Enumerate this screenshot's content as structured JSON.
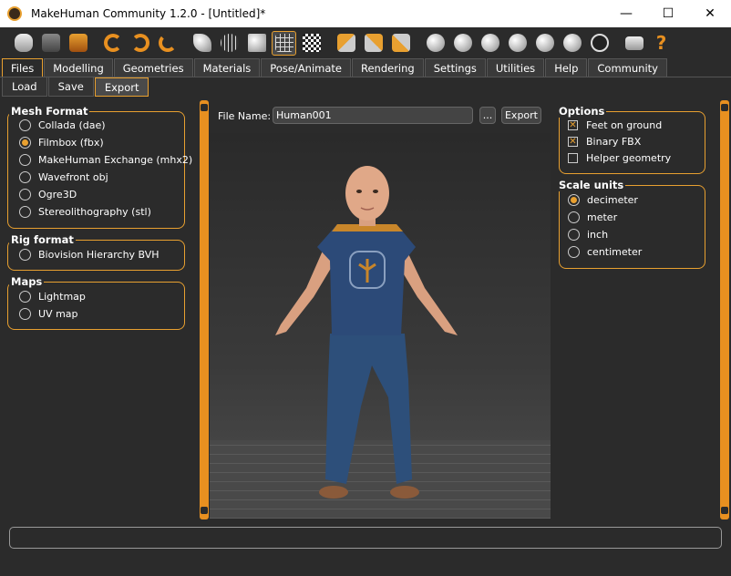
{
  "window": {
    "title": "MakeHuman Community 1.2.0 - [Untitled]*",
    "minimize": "—",
    "maximize": "☐",
    "close": "✕"
  },
  "main_tabs": [
    "Files",
    "Modelling",
    "Geometries",
    "Materials",
    "Pose/Animate",
    "Rendering",
    "Settings",
    "Utilities",
    "Help",
    "Community"
  ],
  "active_main_tab": "Files",
  "sub_tabs": [
    "Load",
    "Save",
    "Export"
  ],
  "active_sub_tab": "Export",
  "mesh_format": {
    "title": "Mesh Format",
    "options": [
      "Collada (dae)",
      "Filmbox (fbx)",
      "MakeHuman Exchange (mhx2)",
      "Wavefront obj",
      "Ogre3D",
      "Stereolithography (stl)"
    ],
    "selected": "Filmbox (fbx)"
  },
  "rig_format": {
    "title": "Rig format",
    "options": [
      "Biovision Hierarchy BVH"
    ]
  },
  "maps": {
    "title": "Maps",
    "options": [
      "Lightmap",
      "UV map"
    ]
  },
  "file": {
    "label": "File Name:",
    "value": "Human001",
    "browse_label": "...",
    "export_label": "Export"
  },
  "options": {
    "title": "Options",
    "items": [
      {
        "label": "Feet on ground",
        "checked": true
      },
      {
        "label": "Binary FBX",
        "checked": true
      },
      {
        "label": "Helper geometry",
        "checked": false
      }
    ]
  },
  "scale_units": {
    "title": "Scale units",
    "options": [
      "decimeter",
      "meter",
      "inch",
      "centimeter"
    ],
    "selected": "decimeter"
  },
  "toolbar_icons": [
    "new-icon",
    "save-icon",
    "export-icon",
    "undo-icon",
    "redo-icon",
    "reset-icon",
    "smooth-icon",
    "wireframe-icon",
    "pose-icon",
    "grid-icon",
    "checker-icon",
    "front-view-icon",
    "left-view-icon",
    "right-view-icon",
    "face-icon",
    "back-icon",
    "side-icon",
    "side2-icon",
    "top-icon",
    "bottom-icon",
    "circle-icon",
    "camera-icon",
    "help-icon"
  ],
  "colors": {
    "accent": "#e8a030",
    "background": "#2b2b2b"
  }
}
